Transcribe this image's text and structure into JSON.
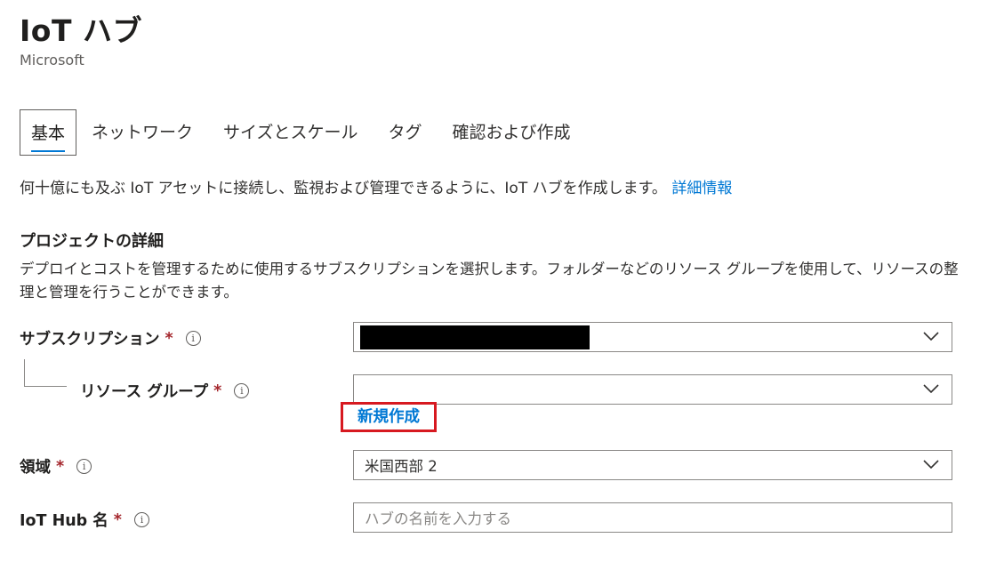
{
  "header": {
    "title": "IoT ハブ",
    "publisher": "Microsoft"
  },
  "tabs": [
    {
      "label": "基本",
      "active": true
    },
    {
      "label": "ネットワーク"
    },
    {
      "label": "サイズとスケール"
    },
    {
      "label": "タグ"
    },
    {
      "label": "確認および作成"
    }
  ],
  "intro": {
    "text": "何十億にも及ぶ IoT アセットに接続し、監視および管理できるように、IoT ハブを作成します。",
    "link": "詳細情報"
  },
  "project": {
    "title": "プロジェクトの詳細",
    "description": "デプロイとコストを管理するために使用するサブスクリプションを選択します。フォルダーなどのリソース グループを使用して、リソースの整理と管理を行うことができます。"
  },
  "form": {
    "subscription": {
      "label": "サブスクリプション",
      "required": "*"
    },
    "resource_group": {
      "label": "リソース グループ",
      "required": "*",
      "value": "",
      "create_new": "新規作成"
    },
    "region": {
      "label": "領域",
      "required": "*",
      "value": "米国西部 2"
    },
    "hub_name": {
      "label": "IoT Hub 名",
      "required": "*",
      "placeholder": "ハブの名前を入力する"
    }
  },
  "icons": {
    "info": "info-icon",
    "dropdown": "chevron-down-icon"
  },
  "colors": {
    "accent": "#0078d4",
    "required": "#a4262c",
    "highlight": "#d71920"
  }
}
